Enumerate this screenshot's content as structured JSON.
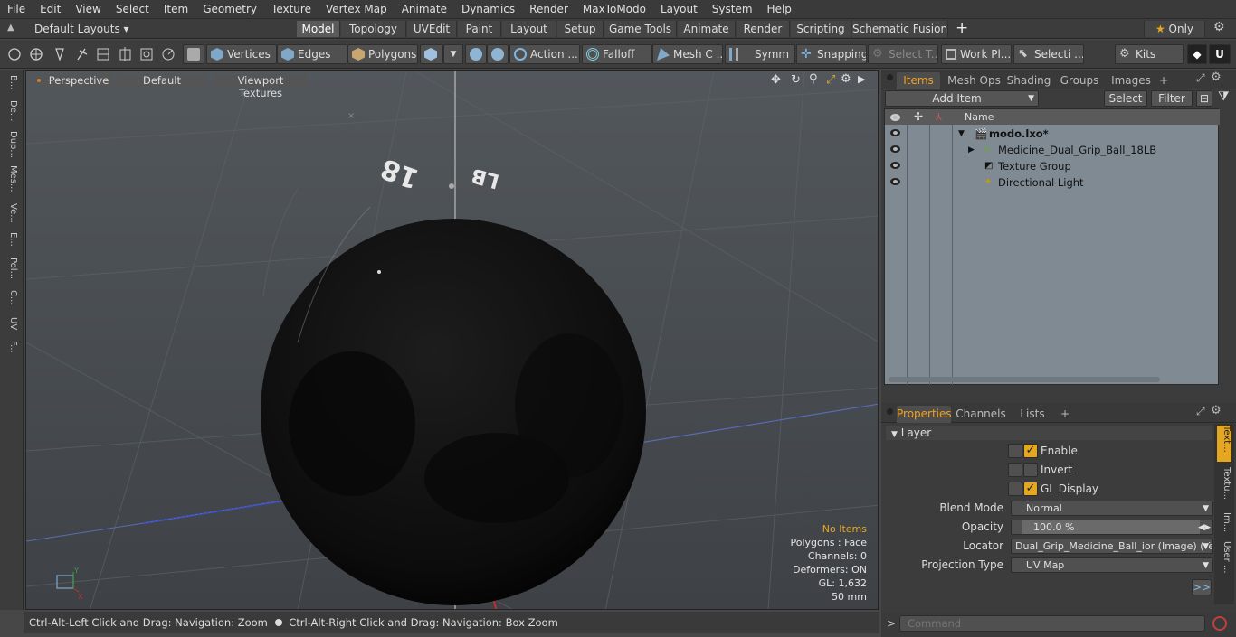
{
  "menu": [
    "File",
    "Edit",
    "View",
    "Select",
    "Item",
    "Geometry",
    "Texture",
    "Vertex Map",
    "Animate",
    "Dynamics",
    "Render",
    "MaxToModo",
    "Layout",
    "System",
    "Help"
  ],
  "layouts": {
    "default_label": "Default Layouts ▾",
    "tabs": [
      "Model",
      "Topology",
      "UVEdit",
      "Paint",
      "Layout",
      "Setup",
      "Game Tools",
      "Animate",
      "Render",
      "Scripting",
      "Schematic Fusion"
    ],
    "plus": "+",
    "only": "Only"
  },
  "toolbar": {
    "vertices": "Vertices",
    "edges": "Edges",
    "polygons": "Polygons",
    "action": "Action ...",
    "falloff": "Falloff",
    "mesh": "Mesh C ...",
    "symm": "Symm ...",
    "snapping": "Snapping",
    "select_t": "Select T...",
    "work_pl": "Work Pl...",
    "selecti": "Selecti ...",
    "kits": "Kits"
  },
  "left_tabs": [
    "B...",
    "De...",
    "Dup...",
    "Mes...",
    "Ve...",
    "E...",
    "Pol...",
    "C...",
    "UV",
    "F..."
  ],
  "viewport": {
    "perspective": "Perspective",
    "default": "Default",
    "textures": "Viewport Textures",
    "ball_text_1": "18",
    "ball_text_2": "LB",
    "info": {
      "no_items": "No Items",
      "polygons": "Polygons : Face",
      "channels": "Channels: 0",
      "deformers": "Deformers: ON",
      "gl": "GL: 1,632",
      "size": "50 mm"
    }
  },
  "status": {
    "left": "Ctrl-Alt-Left Click and Drag: Navigation: Zoom",
    "right": "Ctrl-Alt-Right Click and Drag: Navigation: Box Zoom"
  },
  "items_panel": {
    "tabs": [
      "Items",
      "Mesh Ops",
      "Shading",
      "Groups",
      "Images"
    ],
    "plus": "+",
    "add_item": "Add Item",
    "select": "Select",
    "filter": "Filter",
    "col_name": "Name",
    "rows": [
      "modo.lxo*",
      "Medicine_Dual_Grip_Ball_18LB",
      "Texture Group",
      "Directional Light"
    ]
  },
  "props_panel": {
    "tabs": [
      "Properties",
      "Channels",
      "Lists"
    ],
    "plus": "+",
    "section": "Layer",
    "enable": "Enable",
    "invert": "Invert",
    "gl_display": "GL Display",
    "blend_label": "Blend Mode",
    "blend_value": "Normal",
    "opacity_label": "Opacity",
    "opacity_value": "100.0 %",
    "locator_label": "Locator",
    "locator_value": "Dual_Grip_Medicine_Ball_ior (Image) (Te...",
    "proj_label": "Projection Type",
    "proj_value": "UV Map",
    "more": ">>",
    "side_tabs": [
      "Text...",
      "Textu...",
      "Im...",
      "User ..."
    ]
  },
  "command": {
    "prompt": ">",
    "placeholder": "Command"
  }
}
